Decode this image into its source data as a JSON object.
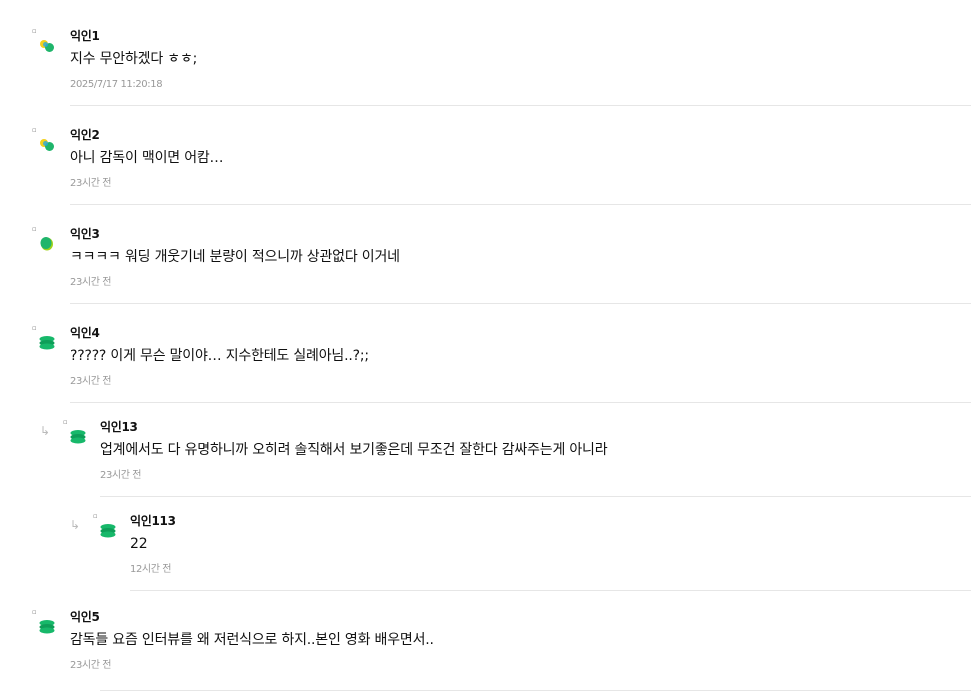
{
  "comments": [
    {
      "author": "익인1",
      "text": "지수 무안하겠다 ㅎㅎ;",
      "time": "2025/7/17 11:20:18",
      "avatar_icon": "yellow-green-pill-icon",
      "avatar_colors": [
        "#f2d11d",
        "#1fb56b",
        "#29a8e0"
      ]
    },
    {
      "author": "익인2",
      "text": "아니 감독이 맥이면 어캄…",
      "time": "23시간 전",
      "avatar_icon": "yellow-green-pill-icon",
      "avatar_colors": [
        "#f2d11d",
        "#1fb56b",
        "#29a8e0"
      ]
    },
    {
      "author": "익인3",
      "text": "ㅋㅋㅋㅋ 워딩 개웃기네 분량이 적으니까 상관없다 이거네",
      "time": "23시간 전",
      "avatar_icon": "green-blob-icon",
      "avatar_colors": [
        "#1fb56b",
        "#9fd21a"
      ]
    },
    {
      "author": "익인4",
      "text": "????? 이게 무슨 말이야… 지수한테도 실례아님..?;;",
      "time": "23시간 전",
      "avatar_icon": "green-stack-icon",
      "avatar_colors": [
        "#17b86a",
        "#0e9e58"
      ]
    },
    {
      "author": "익인13",
      "text": "업계에서도 다 유명하니까 오히려 솔직해서 보기좋은데 무조건 잘한다 감싸주는게 아니라",
      "time": "23시간 전",
      "avatar_icon": "green-stack-icon",
      "avatar_colors": [
        "#17b86a",
        "#0e9e58"
      ]
    },
    {
      "author": "익인113",
      "text": "22",
      "time": "12시간 전",
      "avatar_icon": "green-stack-icon",
      "avatar_colors": [
        "#17b86a",
        "#0e9e58"
      ]
    },
    {
      "author": "익인5",
      "text": "감독들 요즘 인터뷰를 왜 저런식으로 하지..본인 영화 배우면서..",
      "time": "23시간 전",
      "avatar_icon": "green-stack-icon",
      "avatar_colors": [
        "#17b86a",
        "#0e9e58"
      ]
    }
  ],
  "icons": {
    "reply_arrow": "reply-arrow-icon",
    "marker": "small-square-marker"
  }
}
